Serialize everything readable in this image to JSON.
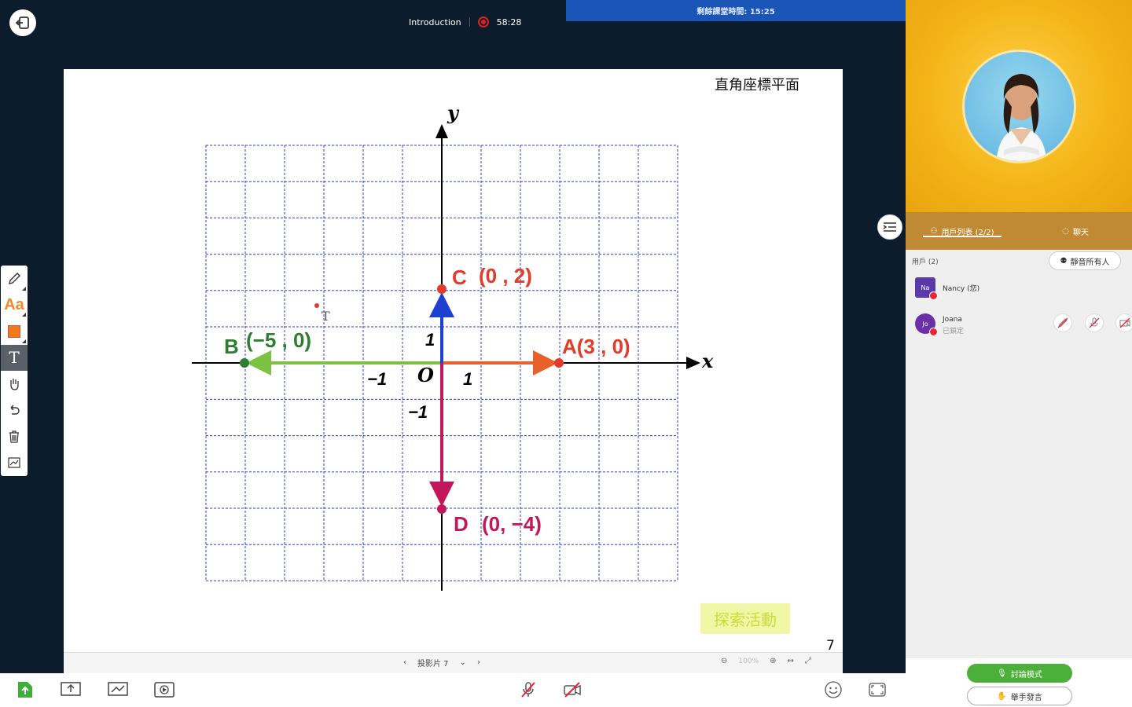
{
  "topbar": {
    "section": "Introduction",
    "elapsed": "58:28",
    "remaining_time": "剩餘課堂時間: 15:25"
  },
  "slide": {
    "title": "直角座標平面",
    "page_number": "7",
    "explore_label": "探索活動",
    "axis_x": "x",
    "axis_y": "y",
    "origin": "O",
    "tick_x_pos": "1",
    "tick_x_neg": "−1",
    "tick_y_pos": "1",
    "tick_y_neg": "−1",
    "point_a": "A(3 , 0)",
    "point_b_letter": "B",
    "point_b": "(−5 , 0)",
    "point_c_letter": "C",
    "point_c": "(0 , 2)",
    "point_d_letter": "D",
    "point_d": "(0, −4)",
    "colors": {
      "a": "#e23b2a",
      "b": "#2e7d32",
      "c": "#e23b2a",
      "d": "#c2185b",
      "grid": "#2a3fcf"
    }
  },
  "footer": {
    "slide_label": "投影片 7",
    "zoom": "100%"
  },
  "toolbar": {
    "items": [
      "pencil-icon",
      "text-style-icon",
      "color-swatch",
      "text-tool-icon",
      "hand-icon",
      "undo-icon",
      "trash-icon",
      "chart-icon"
    ]
  },
  "panel": {
    "tab_users": "用戶列表 (2/2)",
    "tab_chat": "聊天",
    "users_header": "用戶 (2)",
    "mute_all": "靜音所有人",
    "users": [
      {
        "initials": "Na",
        "name": "Nancy (您)",
        "sub": ""
      },
      {
        "initials": "Jo",
        "name": "Joana",
        "sub": "已鎖定"
      }
    ],
    "discuss_mode": "討論模式",
    "raise_hand": "舉手發言"
  }
}
